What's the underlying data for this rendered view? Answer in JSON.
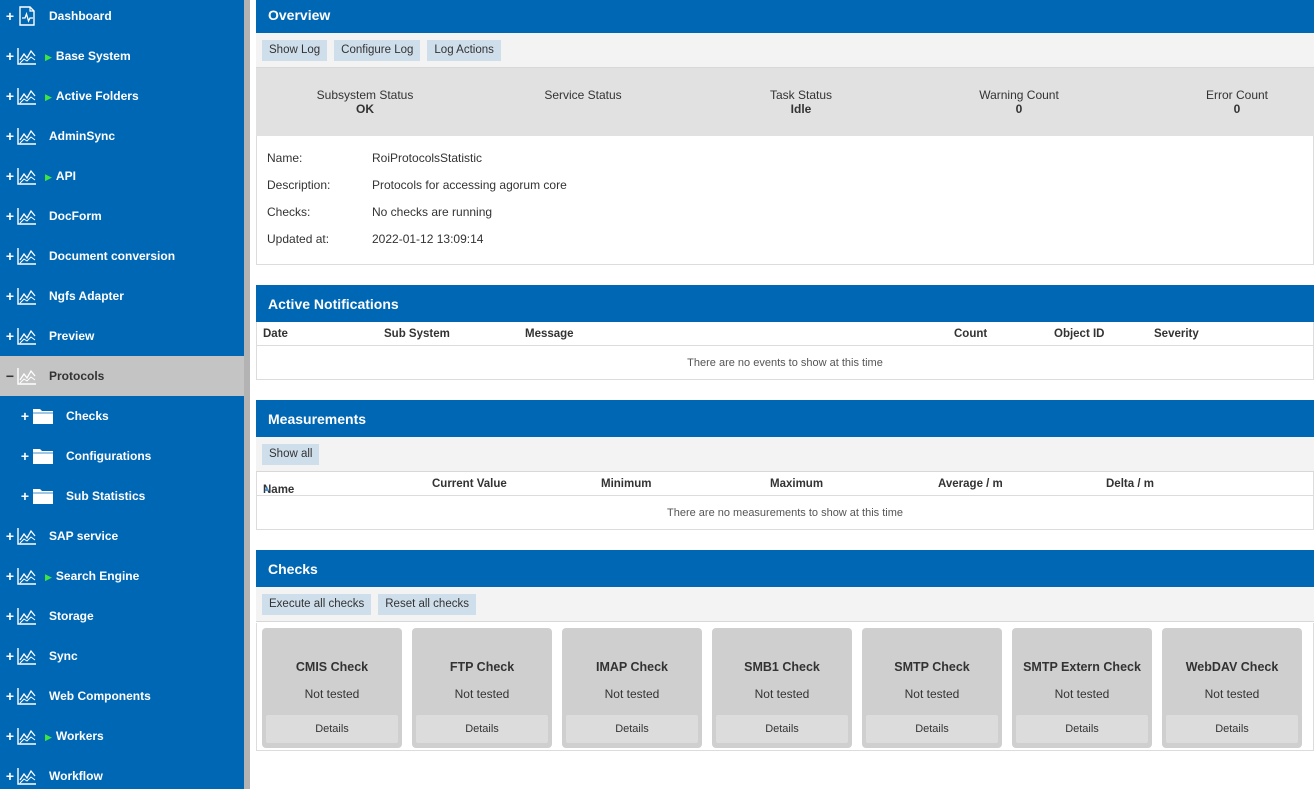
{
  "sidebar": {
    "items": [
      {
        "label": "Dashboard",
        "arrow": ""
      },
      {
        "label": "Base System",
        "arrow": "▶"
      },
      {
        "label": "Active Folders",
        "arrow": "▶"
      },
      {
        "label": "AdminSync",
        "arrow": ""
      },
      {
        "label": "API",
        "arrow": "▶"
      },
      {
        "label": "DocForm",
        "arrow": ""
      },
      {
        "label": "Document conversion",
        "arrow": ""
      },
      {
        "label": "Ngfs Adapter",
        "arrow": ""
      },
      {
        "label": "Preview",
        "arrow": ""
      },
      {
        "label": "Protocols",
        "arrow": ""
      },
      {
        "label": "Checks",
        "arrow": ""
      },
      {
        "label": "Configurations",
        "arrow": ""
      },
      {
        "label": "Sub Statistics",
        "arrow": ""
      },
      {
        "label": "SAP service",
        "arrow": ""
      },
      {
        "label": "Search Engine",
        "arrow": "▶"
      },
      {
        "label": "Storage",
        "arrow": ""
      },
      {
        "label": "Sync",
        "arrow": ""
      },
      {
        "label": "Web Components",
        "arrow": ""
      },
      {
        "label": "Workers",
        "arrow": "▶"
      },
      {
        "label": "Workflow",
        "arrow": ""
      }
    ],
    "expand_symbol": "+",
    "collapse_symbol": "−",
    "selected_index": 9
  },
  "overview": {
    "title": "Overview",
    "buttons": [
      "Show Log",
      "Configure Log",
      "Log Actions"
    ],
    "status": [
      {
        "label": "Subsystem Status",
        "value": "OK"
      },
      {
        "label": "Service Status",
        "value": ""
      },
      {
        "label": "Task Status",
        "value": "Idle"
      },
      {
        "label": "Warning Count",
        "value": "0"
      },
      {
        "label": "Error Count",
        "value": "0"
      }
    ],
    "info": [
      {
        "key": "Name:",
        "value": "RoiProtocolsStatistic"
      },
      {
        "key": "Description:",
        "value": "Protocols for accessing agorum core"
      },
      {
        "key": "Checks:",
        "value": "No checks are running"
      },
      {
        "key": "Updated at:",
        "value": "2022-01-12 13:09:14"
      }
    ]
  },
  "notifications": {
    "title": "Active Notifications",
    "columns": [
      "Date",
      "Sub System",
      "Message",
      "Count",
      "Object ID",
      "Severity"
    ],
    "empty": "There are no events to show at this time"
  },
  "measurements": {
    "title": "Measurements",
    "button": "Show all",
    "columns": [
      "Name",
      "Current Value",
      "Minimum",
      "Maximum",
      "Average / m",
      "Delta / m"
    ],
    "sort_indicator": "▲",
    "empty": "There are no measurements to show at this time"
  },
  "checks": {
    "title": "Checks",
    "buttons": [
      "Execute all checks",
      "Reset all checks"
    ],
    "cards": [
      {
        "title": "CMIS Check",
        "status": "Not tested",
        "action": "Details"
      },
      {
        "title": "FTP Check",
        "status": "Not tested",
        "action": "Details"
      },
      {
        "title": "IMAP Check",
        "status": "Not tested",
        "action": "Details"
      },
      {
        "title": "SMB1 Check",
        "status": "Not tested",
        "action": "Details"
      },
      {
        "title": "SMTP Check",
        "status": "Not tested",
        "action": "Details"
      },
      {
        "title": "SMTP Extern Check",
        "status": "Not tested",
        "action": "Details"
      },
      {
        "title": "WebDAV Check",
        "status": "Not tested",
        "action": "Details"
      }
    ]
  },
  "colors": {
    "brand_blue": "#0067b4",
    "selected_gray": "#c4c4c4",
    "arrow_green": "#3ee63e",
    "button_blue": "#cfdeeb"
  }
}
